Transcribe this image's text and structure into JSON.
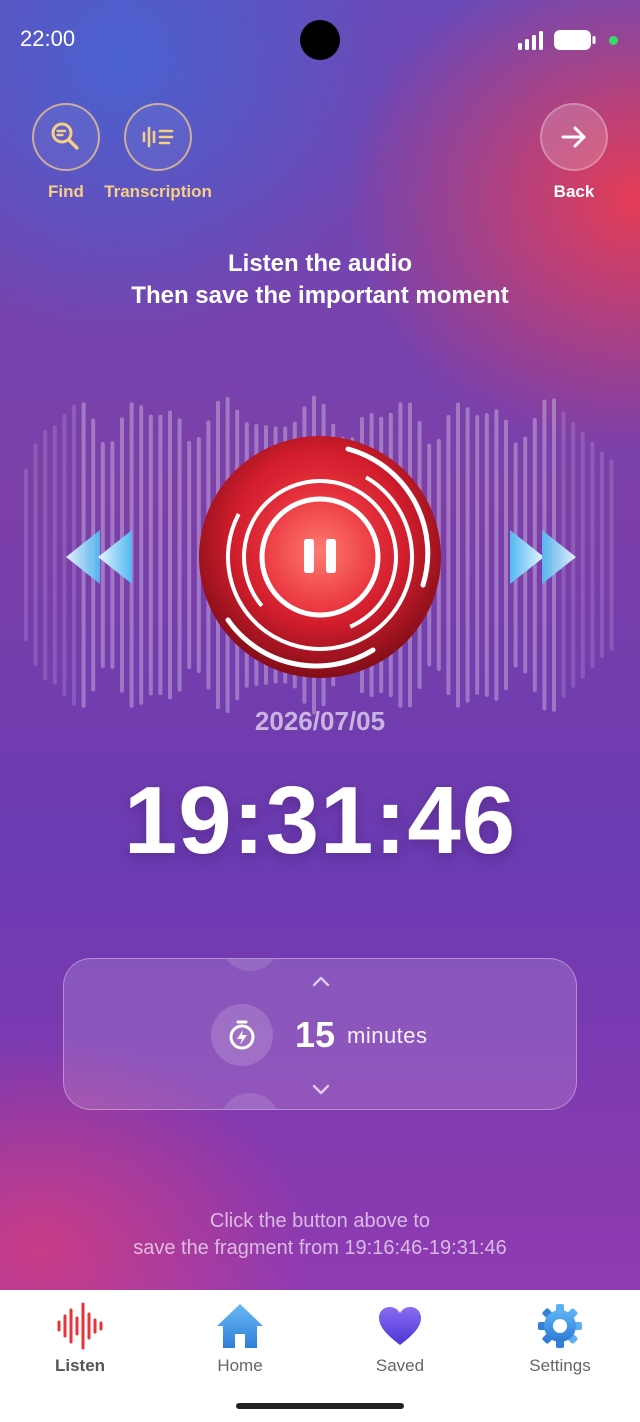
{
  "status": {
    "time": "22:00"
  },
  "top": {
    "find_label": "Find",
    "transcription_label": "Transcription",
    "back_label": "Back"
  },
  "instructions": {
    "line1": "Listen the audio",
    "line2": "Then save the important moment"
  },
  "player": {
    "date": "2026/07/05",
    "clock": "19:31:46"
  },
  "duration": {
    "value": "15",
    "unit": "minutes"
  },
  "hint": {
    "line1": "Click the button above to",
    "line2": "save the fragment from 19:16:46-19:31:46"
  },
  "nav": {
    "items": [
      {
        "label": "Listen",
        "icon": "waveform-icon",
        "active": true
      },
      {
        "label": "Home",
        "icon": "home-icon",
        "active": false
      },
      {
        "label": "Saved",
        "icon": "heart-icon",
        "active": false
      },
      {
        "label": "Settings",
        "icon": "gear-icon",
        "active": false
      }
    ]
  },
  "colors": {
    "accent_red": "#e8323c",
    "label_gold": "#f5cf86",
    "arrow_blue": "#6ec6f5"
  }
}
